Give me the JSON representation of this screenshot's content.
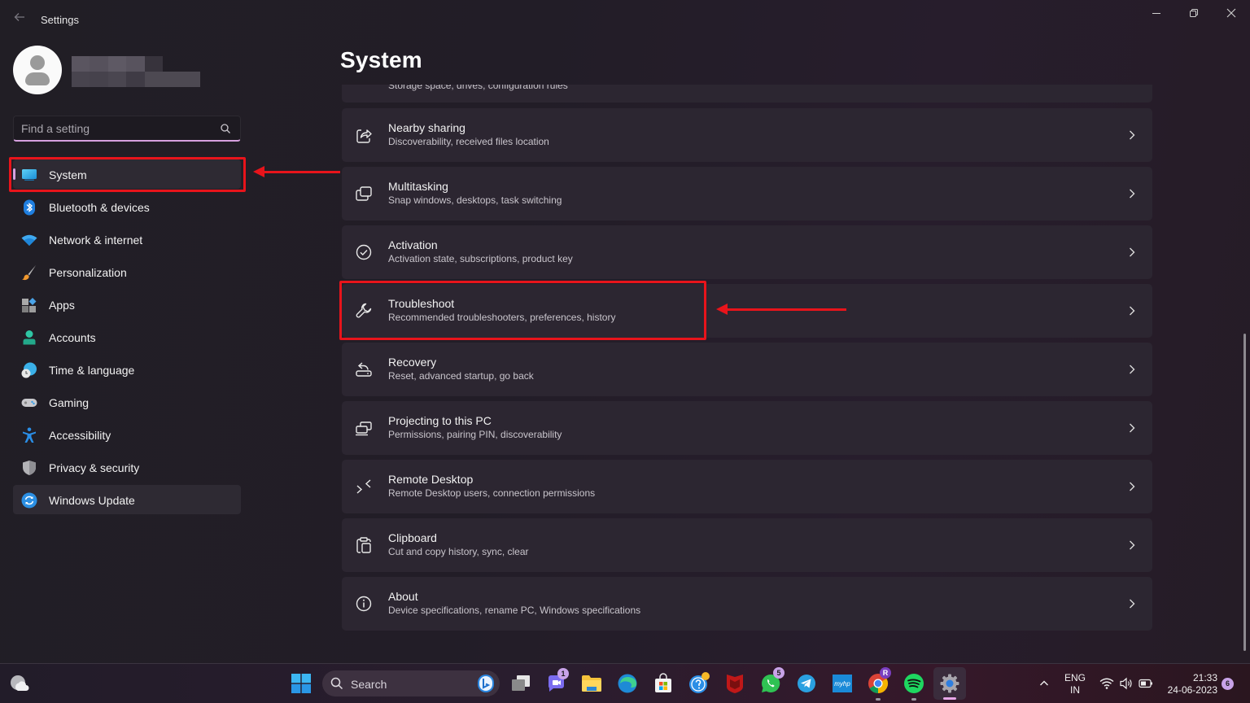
{
  "window": {
    "title": "Settings",
    "controls": {
      "minimize": "minimize",
      "maximize": "restore",
      "close": "close"
    }
  },
  "profile": {
    "name_redacted": true
  },
  "search": {
    "placeholder": "Find a setting",
    "value": ""
  },
  "sidebar": {
    "items": [
      {
        "label": "System",
        "icon": "system-display-icon",
        "active": true
      },
      {
        "label": "Bluetooth & devices",
        "icon": "bluetooth-icon"
      },
      {
        "label": "Network & internet",
        "icon": "wifi-icon"
      },
      {
        "label": "Personalization",
        "icon": "paintbrush-icon"
      },
      {
        "label": "Apps",
        "icon": "apps-icon"
      },
      {
        "label": "Accounts",
        "icon": "person-icon"
      },
      {
        "label": "Time & language",
        "icon": "globe-clock-icon"
      },
      {
        "label": "Gaming",
        "icon": "gamepad-icon"
      },
      {
        "label": "Accessibility",
        "icon": "accessibility-icon"
      },
      {
        "label": "Privacy & security",
        "icon": "shield-icon"
      },
      {
        "label": "Windows Update",
        "icon": "update-icon"
      }
    ]
  },
  "main": {
    "title": "System",
    "partial_card": {
      "subtitle": "Storage space, drives, configuration rules"
    },
    "cards": [
      {
        "title": "Nearby sharing",
        "subtitle": "Discoverability, received files location",
        "icon": "share-icon"
      },
      {
        "title": "Multitasking",
        "subtitle": "Snap windows, desktops, task switching",
        "icon": "multitasking-icon"
      },
      {
        "title": "Activation",
        "subtitle": "Activation state, subscriptions, product key",
        "icon": "check-circle-icon"
      },
      {
        "title": "Troubleshoot",
        "subtitle": "Recommended troubleshooters, preferences, history",
        "icon": "wrench-icon",
        "highlighted": true
      },
      {
        "title": "Recovery",
        "subtitle": "Reset, advanced startup, go back",
        "icon": "recovery-icon"
      },
      {
        "title": "Projecting to this PC",
        "subtitle": "Permissions, pairing PIN, discoverability",
        "icon": "projecting-icon"
      },
      {
        "title": "Remote Desktop",
        "subtitle": "Remote Desktop users, connection permissions",
        "icon": "remote-desktop-icon"
      },
      {
        "title": "Clipboard",
        "subtitle": "Cut and copy history, sync, clear",
        "icon": "clipboard-icon"
      },
      {
        "title": "About",
        "subtitle": "Device specifications, rename PC, Windows specifications",
        "icon": "info-icon"
      }
    ]
  },
  "annotations": {
    "color": "#e8141b",
    "targets": [
      "System",
      "Troubleshoot"
    ]
  },
  "taskbar": {
    "search_label": "Search",
    "apps": [
      {
        "name": "Task View"
      },
      {
        "name": "Teams Chat",
        "badge": "1"
      },
      {
        "name": "File Explorer"
      },
      {
        "name": "Microsoft Edge"
      },
      {
        "name": "Microsoft Store"
      },
      {
        "name": "Get Help"
      },
      {
        "name": "McAfee"
      },
      {
        "name": "WhatsApp",
        "badge": "5"
      },
      {
        "name": "Telegram"
      },
      {
        "name": "myHP"
      },
      {
        "name": "Google Chrome",
        "badge": "R",
        "running": true
      },
      {
        "name": "Spotify",
        "running": true
      },
      {
        "name": "Settings",
        "active": true
      }
    ],
    "tray": {
      "language_top": "ENG",
      "language_bottom": "IN",
      "time": "21:33",
      "date": "24-06-2023",
      "notification_count": "6"
    }
  },
  "colors": {
    "accent": "#d7a1e0",
    "background": "#211d24",
    "card": "#2c2631",
    "annotation": "#e8141b"
  }
}
